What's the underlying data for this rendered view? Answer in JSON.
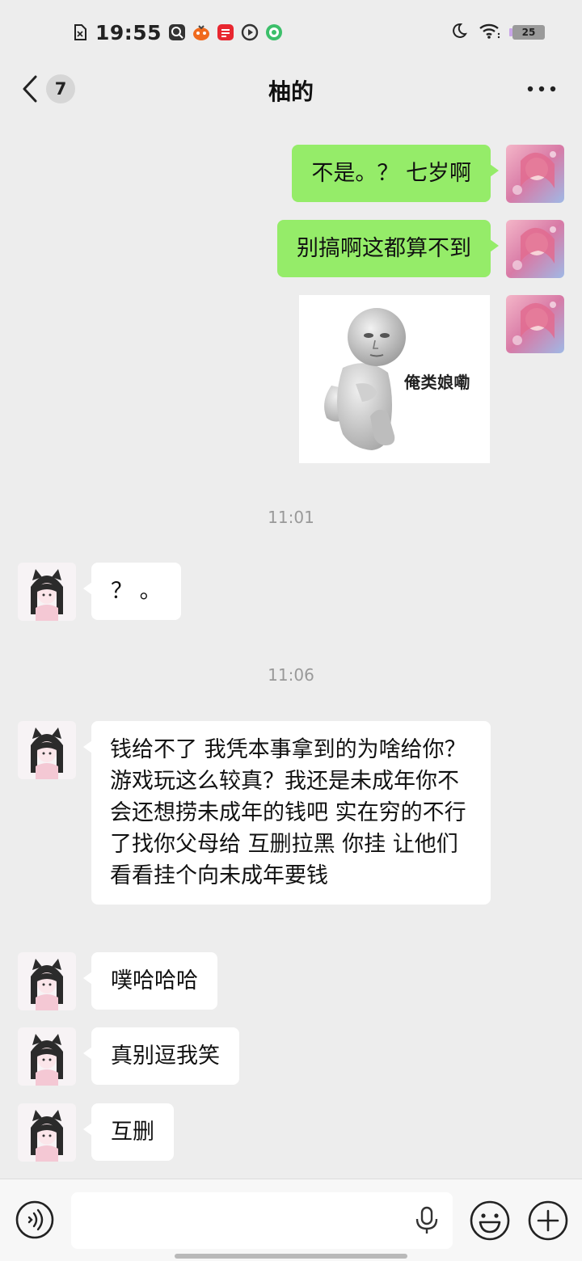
{
  "status_bar": {
    "time": "19:55",
    "battery": "25",
    "icons": [
      "sim-card-icon",
      "search-app-icon",
      "taobao-icon",
      "red-app-icon",
      "play-icon",
      "game-icon",
      "moon-icon",
      "wifi-icon",
      "battery-icon"
    ]
  },
  "header": {
    "unread_count": "7",
    "title": "柚的"
  },
  "messages": [
    {
      "from": "me",
      "type": "text",
      "text": "不是。？ 七岁啊"
    },
    {
      "from": "me",
      "type": "text",
      "text": "别搞啊这都算不到"
    },
    {
      "from": "me",
      "type": "sticker",
      "text": "俺类娘嘞"
    },
    {
      "type": "time",
      "text": "11:01"
    },
    {
      "from": "other",
      "type": "text",
      "text": "？ 。"
    },
    {
      "type": "time",
      "text": "11:06"
    },
    {
      "from": "other",
      "type": "text",
      "text": "钱给不了 我凭本事拿到的为啥给你？ 游戏玩这么较真？我还是未成年你不会还想捞未成年的钱吧 实在穷的不行了找你父母给 互删拉黑 你挂 让他们看看挂个向未成年要钱"
    },
    {
      "from": "other",
      "type": "text",
      "text": "噗哈哈哈"
    },
    {
      "from": "other",
      "type": "text",
      "text": "真别逗我笑"
    },
    {
      "from": "other",
      "type": "text",
      "text": "互删"
    }
  ],
  "input_bar": {
    "icons": [
      "voice-icon",
      "mic-icon",
      "emoji-icon",
      "plus-icon"
    ]
  },
  "colors": {
    "background": "#ededed",
    "my_bubble": "#95ec69",
    "other_bubble": "#ffffff",
    "timestamp": "#999999"
  }
}
